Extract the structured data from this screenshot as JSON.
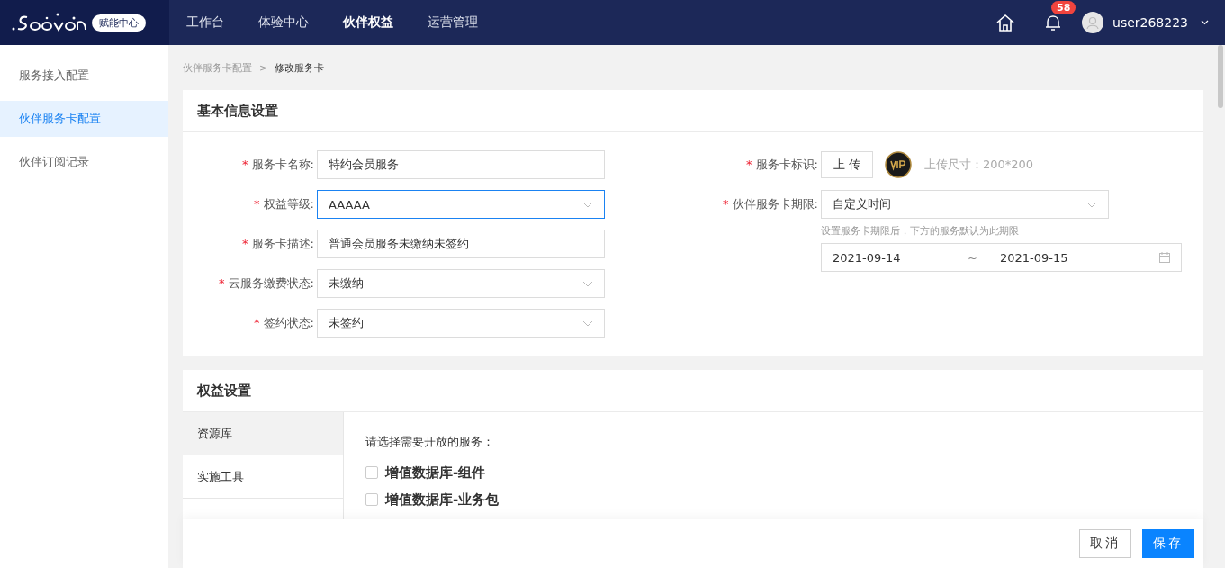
{
  "nav": {
    "logo_badge": "赋能中心",
    "menu": [
      {
        "label": "工作台",
        "selected": false
      },
      {
        "label": "体验中心",
        "selected": false
      },
      {
        "label": "伙伴权益",
        "selected": true
      },
      {
        "label": "运营管理",
        "selected": false
      }
    ],
    "notification_count": "58",
    "user": "user268223"
  },
  "sidebar": {
    "items": [
      {
        "label": "服务接入配置",
        "selected": false
      },
      {
        "label": "伙伴服务卡配置",
        "selected": true
      },
      {
        "label": "伙伴订阅记录",
        "selected": false
      }
    ]
  },
  "breadcrumb": [
    {
      "label": "伙伴服务卡配置",
      "current": false
    },
    {
      "label": "修改服务卡",
      "current": true
    }
  ],
  "breadcrumb_separator": ">",
  "basic_info": {
    "title": "基本信息设置",
    "fields": [
      {
        "label": "服务卡名称:",
        "required_mark": "*",
        "kind": "text",
        "value": "特约会员服务",
        "focused": false
      },
      {
        "label": "权益等级:",
        "required_mark": "*",
        "kind": "select",
        "value": "AAAAA",
        "focused": true
      },
      {
        "label": "服务卡描述:",
        "required_mark": "*",
        "kind": "text",
        "value": "普通会员服务未缴纳未签约",
        "focused": false
      },
      {
        "label": "云服务缴费状态:",
        "required_mark": "*",
        "kind": "select",
        "value": "未缴纳",
        "focused": false
      },
      {
        "label": "签约状态:",
        "required_mark": "*",
        "kind": "select",
        "value": "未签约",
        "focused": false
      }
    ],
    "logo": {
      "label": "服务卡标识:",
      "required_mark": "*",
      "button": "上 传",
      "hint": "上传尺寸：200*200"
    },
    "period": {
      "label": "伙伴服务卡期限:",
      "required_mark": "*",
      "value": "自定义时间",
      "hint": "设置服务卡期限后，下方的服务默认为此期限",
      "start": "2021-09-14",
      "separator": "~",
      "end": "2021-09-15"
    }
  },
  "rights": {
    "title": "权益设置",
    "tabs": [
      {
        "label": "资源库",
        "selected": true
      },
      {
        "label": "实施工具",
        "selected": false
      }
    ],
    "prompt": "请选择需要开放的服务：",
    "options": [
      {
        "label": "增值数据库-组件",
        "checked": false
      },
      {
        "label": "增值数据库-业务包",
        "checked": false
      }
    ]
  },
  "footer": {
    "buttons": [
      {
        "label": "取消",
        "kind": "default"
      },
      {
        "label": "保存",
        "kind": "primary"
      }
    ]
  }
}
